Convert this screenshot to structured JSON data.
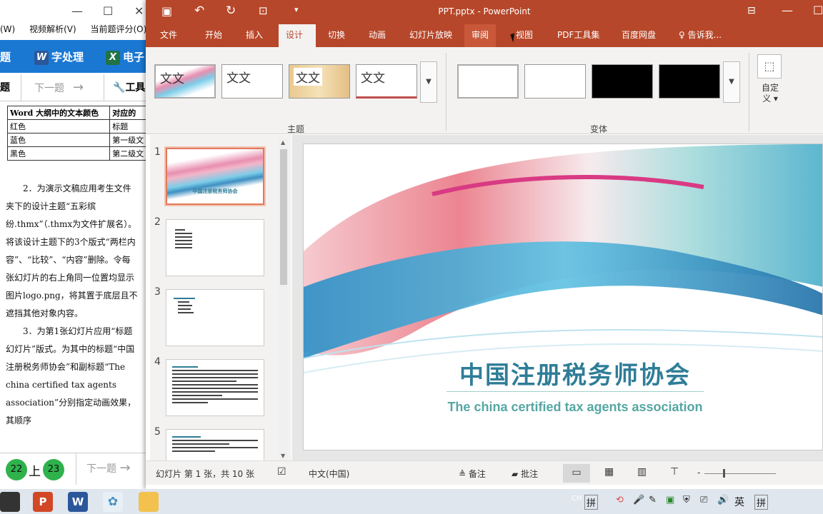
{
  "left_app": {
    "menu": [
      "(W)",
      "视频解析(V)",
      "当前题评分(O)"
    ],
    "toolbar": {
      "item1": "题",
      "item2": "字处理",
      "item3": "电子"
    },
    "nav": {
      "topic": "题",
      "next": "下一题",
      "tools": "工具"
    },
    "table": {
      "headers": [
        "Word 大纲中的文本颜色",
        "对应的"
      ],
      "rows": [
        [
          "红色",
          "标题"
        ],
        [
          "蓝色",
          "第一级文"
        ],
        [
          "黑色",
          "第二级文"
        ]
      ]
    },
    "paragraphs": [
      "2．为演示文稿应用考生文件夹下的设计主题“五彩缤纷.thmx”（.thmx为文件扩展名）。将该设计主题下的3个版式“两栏内容”、“比较”、“内容”删除。令每张幻灯片的右上角同一位置均显示图片logo.png，将其置于底层且不遮挡其他对象内容。",
      "3．为第1张幻灯片应用“标题幻灯片”版式。为其中的标题“中国注册税务师协会”和副标题“The china certified tax agents association”分别指定动画效果，其顺序"
    ],
    "bottom": {
      "page_a": "22",
      "prev": "上",
      "page_b": "23",
      "next": "下一题"
    }
  },
  "ppt": {
    "title": "PPT.pptx - PowerPoint",
    "tabs": [
      "文件",
      "开始",
      "插入",
      "设计",
      "切换",
      "动画",
      "幻灯片放映",
      "审阅",
      "视图",
      "PDF工具集",
      "百度网盘"
    ],
    "active_tab": "设计",
    "tell_me": "告诉我...",
    "ribbon": {
      "theme_group": "主题",
      "variant_group": "变体",
      "customize": "自定义",
      "theme_label": "文文"
    },
    "slides": [
      "1",
      "2",
      "3",
      "4",
      "5"
    ],
    "slide1": {
      "title": "中国注册税务师协会",
      "subtitle": "The china certified tax agents association"
    },
    "status": {
      "slide_info": "幻灯片 第 1 张，共 10 张",
      "language": "中文(中国)",
      "notes": "备注",
      "comments": "批注",
      "zoom_minus": "-"
    },
    "colors": {
      "accent": "#b7472a",
      "title_blue": "#2f7d97",
      "sub_teal": "#55a7a3"
    }
  },
  "taskbar": {
    "ime1": "拼",
    "ime_lang": "英",
    "ime2": "拼",
    "ch": "CH"
  }
}
